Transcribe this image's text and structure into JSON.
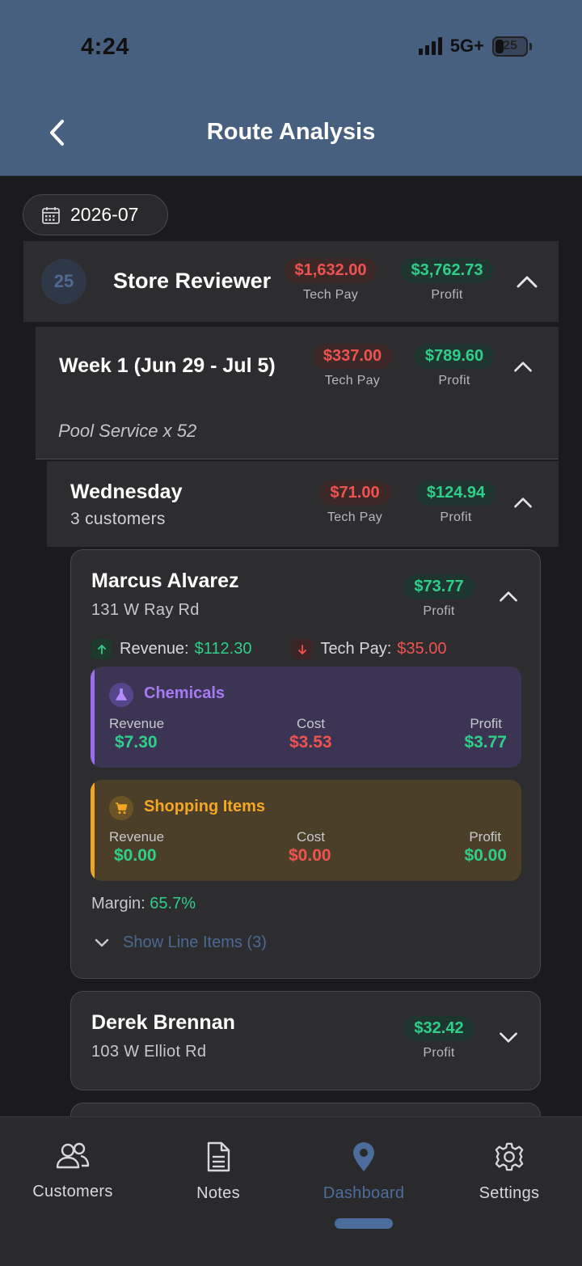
{
  "status_bar": {
    "time": "4:24",
    "network": "5G+",
    "battery": "25"
  },
  "header": {
    "title": "Route Analysis"
  },
  "date_filter": {
    "label": "2026-07"
  },
  "store": {
    "badge": "25",
    "name": "Store Reviewer",
    "tech_pay": "$1,632.00",
    "tech_pay_label": "Tech Pay",
    "profit": "$3,762.73",
    "profit_label": "Profit"
  },
  "week": {
    "name": "Week 1 (Jun 29 - Jul 5)",
    "tech_pay": "$337.00",
    "tech_pay_label": "Tech Pay",
    "profit": "$789.60",
    "profit_label": "Profit",
    "summary": "Pool Service x 52"
  },
  "day": {
    "name": "Wednesday",
    "customers": "3 customers",
    "tech_pay": "$71.00",
    "tech_pay_label": "Tech Pay",
    "profit": "$124.94",
    "profit_label": "Profit"
  },
  "customers": [
    {
      "name": "Marcus Alvarez",
      "address": "131 W Ray Rd",
      "profit": "$73.77",
      "profit_label": "Profit",
      "revenue_label": "Revenue:",
      "revenue": "$112.30",
      "tech_pay_label": "Tech Pay:",
      "tech_pay": "$35.00",
      "chemicals": {
        "title": "Chemicals",
        "revenue_label": "Revenue",
        "revenue": "$7.30",
        "cost_label": "Cost",
        "cost": "$3.53",
        "profit_label": "Profit",
        "profit": "$3.77"
      },
      "shopping": {
        "title": "Shopping Items",
        "revenue_label": "Revenue",
        "revenue": "$0.00",
        "cost_label": "Cost",
        "cost": "$0.00",
        "profit_label": "Profit",
        "profit": "$0.00"
      },
      "margin_label": "Margin:",
      "margin": "65.7%",
      "show_items": "Show Line Items (3)"
    },
    {
      "name": "Derek Brennan",
      "address": "103 W Elliot Rd",
      "profit": "$32.42",
      "profit_label": "Profit"
    }
  ],
  "nav": {
    "items": [
      {
        "label": "Customers",
        "icon": "users-icon"
      },
      {
        "label": "Notes",
        "icon": "document-icon"
      },
      {
        "label": "Dashboard",
        "icon": "location-pin-icon"
      },
      {
        "label": "Settings",
        "icon": "gear-icon"
      }
    ]
  },
  "colors": {
    "header_bg": "#48607f",
    "accent": "#4c6d9c",
    "positive": "#2fcf8a",
    "negative": "#ef5350",
    "chemicals": "#9b6cf0",
    "shopping": "#f0a623"
  }
}
